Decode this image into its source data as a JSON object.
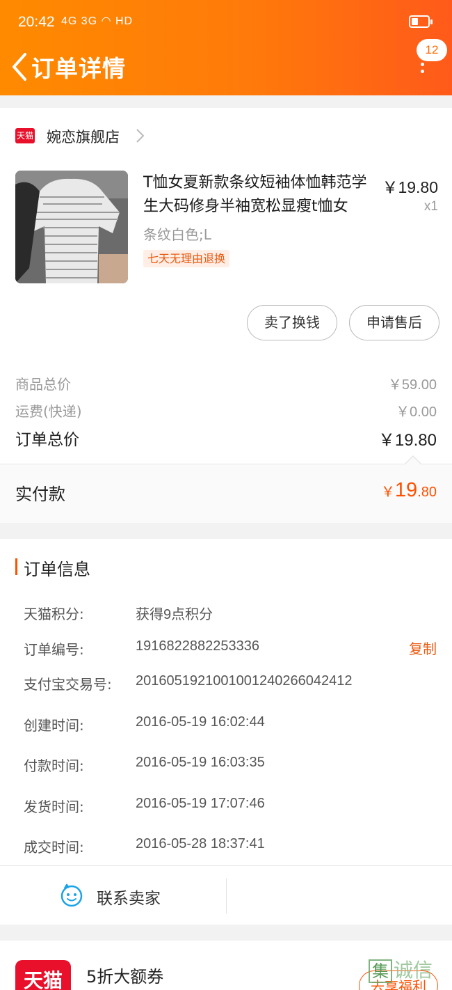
{
  "status_bar": {
    "time": "20:42",
    "network": "4G 3G",
    "wifi": "HD"
  },
  "header": {
    "title": "订单详情",
    "badge_count": "12"
  },
  "shop": {
    "platform_badge": "天猫",
    "name": "婉恋旗舰店"
  },
  "product": {
    "title": "T恤女夏新款条纹短袖体恤韩范学生大码修身半袖宽松显瘦t恤女",
    "price": "￥19.80",
    "quantity": "x1",
    "sku": "条纹白色;L",
    "tag": "七天无理由退换"
  },
  "actions": {
    "sell": "卖了换钱",
    "after_sale": "申请售后"
  },
  "fees": {
    "goods_label": "商品总价",
    "goods_value": "￥59.00",
    "shipping_label": "运费(快递)",
    "shipping_value": "￥0.00",
    "total_label": "订单总价",
    "total_value": "￥19.80"
  },
  "paid": {
    "label": "实付款",
    "currency": "￥",
    "integer": "19",
    "decimal": ".80"
  },
  "order_info": {
    "section_title": "订单信息",
    "rows": [
      {
        "label": "天猫积分:",
        "value": "获得9点积分"
      },
      {
        "label": "订单编号:",
        "value": "1916822882253336"
      },
      {
        "label": "支付宝交易号:",
        "value": "2016051921001001240266042412"
      },
      {
        "label": "创建时间:",
        "value": "2016-05-19 16:02:44"
      },
      {
        "label": "付款时间:",
        "value": "2016-05-19 16:03:35"
      },
      {
        "label": "发货时间:",
        "value": "2016-05-19 17:07:46"
      },
      {
        "label": "成交时间:",
        "value": "2016-05-28 18:37:41"
      }
    ],
    "copy_label": "复制"
  },
  "contact": {
    "label": "联系卖家"
  },
  "promo": {
    "logo": "天猫",
    "text": "5折大额券",
    "button": "去享福利"
  },
  "watermark": {
    "box": "集",
    "text": "诚信"
  },
  "colors": {
    "accent": "#ff5000",
    "header_start": "#ff8a00",
    "header_end": "#ff5a1a",
    "tmall_red": "#e8102a"
  }
}
